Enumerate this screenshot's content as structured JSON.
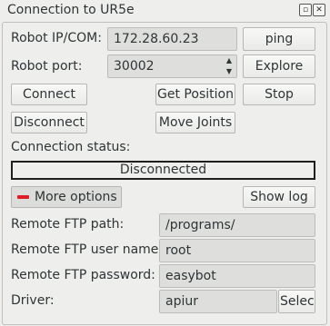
{
  "window": {
    "title": "Connection to UR5e",
    "float_icon": "float-icon",
    "close_icon": "close-icon"
  },
  "connection": {
    "ip_label": "Robot IP/COM:",
    "ip_value": "172.28.60.23",
    "ping_label": "ping",
    "port_label": "Robot port:",
    "port_value": "30002",
    "explore_label": "Explore",
    "connect_label": "Connect",
    "get_position_label": "Get Position",
    "stop_label": "Stop",
    "disconnect_label": "Disconnect",
    "move_joints_label": "Move Joints",
    "status_label": "Connection status:",
    "status_value": "Disconnected"
  },
  "options": {
    "more_options_label": "More options",
    "more_options_icon": "minus-icon",
    "more_options_icon_color": "#e01b24",
    "show_log_label": "Show log"
  },
  "ftp": {
    "path_label": "Remote FTP path:",
    "path_value": "/programs/",
    "user_label": "Remote FTP user name:",
    "user_value": "root",
    "password_label": "Remote FTP password:",
    "password_value": "easybot",
    "driver_label": "Driver:",
    "driver_value": "apiur",
    "select_label": "Select"
  }
}
